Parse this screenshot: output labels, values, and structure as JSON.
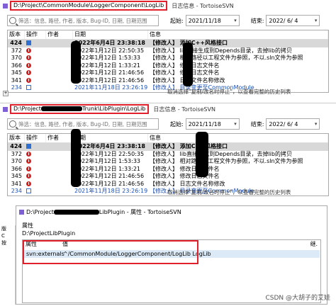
{
  "win1": {
    "path": "D:\\Project\\CommonModule\\LoggerComponent\\LogLib",
    "title_suffix": "日志信息 - TortoiseSVN",
    "search_placeholder": "筛选：信息, 路径, 作者, 版本, Bug-ID, 日期, 日期范围",
    "from_label": "起始:",
    "from_date": "2021/11/18",
    "to_label": "结束:",
    "to_date": "2022/ 6/ 4",
    "headers": [
      "版本",
      "操作",
      "作者",
      "日期",
      "信息"
    ],
    "rows": [
      {
        "rev": "424",
        "icon": "add",
        "date": "2022年6月4日 23:38:18",
        "msg": "【修改人】 添加C++风格接口",
        "style": "selected"
      },
      {
        "rev": "372",
        "icon": "error",
        "date": "2022年1月12日 22:50:35",
        "msg": "【修改人】 lib直接生成到Depends目录，去掉lib的拷贝",
        "style": ""
      },
      {
        "rev": "370",
        "icon": "error",
        "date": "2022年1月12日 1:53:33",
        "msg": "【修改人】 相对路径以工程文件为参照，不以.sln文件为参照",
        "style": ""
      },
      {
        "rev": "366",
        "icon": "error",
        "date": "2022年1月12日 1:33:21",
        "msg": "【修改人】 修改日志文件名",
        "style": ""
      },
      {
        "rev": "345",
        "icon": "error",
        "date": "2022年1月12日 21:46:56",
        "msg": "【修改人】 修改日志文件名",
        "style": ""
      },
      {
        "rev": "341",
        "icon": "error",
        "date": "2022年1月12日 21:46:56",
        "msg": "【修改人】 日志文件名称修改",
        "style": ""
      },
      {
        "rev": "234",
        "icon": "add-hollow",
        "date": "2021年11月18日 23:26:19",
        "msg": "【修改人】 目录变更至CommonModule",
        "style": "blue"
      }
    ],
    "status": "取消选择\"复制/改名时停止\"，以查看完整的历史列表"
  },
  "win2": {
    "path_start": "D:\\Project",
    "path_end": "Trunk\\LibPlugin\\LogLib",
    "title_suffix": "日志信息 - TortoiseSVN",
    "search_placeholder": "筛选：信息, 路径, 作者, 版本, Bug-ID, 日期, 日期范围",
    "from_label": "起始:",
    "from_date": "2021/11/18",
    "to_label": "结束:",
    "to_date": "2022/ 6/ 4",
    "headers": [
      "版本",
      "操作",
      "作者",
      "日期",
      "信息"
    ],
    "rows": [
      {
        "rev": "424",
        "icon": "add",
        "date": "2022年6月4日 23:38:18",
        "msg": "【修改人】 添加C++风格接口",
        "style": "selected"
      },
      {
        "rev": "372",
        "icon": "error",
        "date": "2022年1月12日 22:50:35",
        "msg": "【修改人】 lib直接生成到Depends目录，去掉lib的拷贝",
        "style": ""
      },
      {
        "rev": "370",
        "icon": "error",
        "date": "2022年1月12日 1:53:33",
        "msg": "【修改人】 相对路径以工程文件为参照，不以.sln文件为参照",
        "style": ""
      },
      {
        "rev": "366",
        "icon": "error",
        "date": "2022年1月12日 1:33:21",
        "msg": "【修改人】 修改日志文件名",
        "style": ""
      },
      {
        "rev": "345",
        "icon": "error",
        "date": "2022年1月12日 21:46:56",
        "msg": "【修改人】 修改日志文件名",
        "style": ""
      },
      {
        "rev": "341",
        "icon": "error",
        "date": "2022年1月12日 21:46:56",
        "msg": "【修改人】 日志文件名称修改",
        "style": ""
      },
      {
        "rev": "234",
        "icon": "add-hollow",
        "date": "2021年11月18日 23:26:19",
        "msg": "【修改人】 目录变更至CommonModule",
        "style": "blue"
      }
    ],
    "status": "取消选择\"复制/改名时停止\"，以查看完整的历史列表"
  },
  "dialog": {
    "title_start": "D:\\Project",
    "title_end": "LibPlugin - 属性 - TortoiseSVN",
    "group_label": "属性",
    "path_start": "D:\\Project",
    "path_end": "LibPlugin",
    "col_name": "属性",
    "col_value": "值",
    "col_extra": "继.",
    "prop_name": "svn:externals",
    "prop_value": "^/CommonModule/LoggerComponent/LogLib  LogLib"
  },
  "left_strip": {
    "items": [
      "版",
      "C",
      "按"
    ]
  },
  "watermark": "CSDN @大胡子的艾娃",
  "colors": {
    "highlight_red": "#e0202a",
    "link_blue": "#1a4fb4",
    "selected_gray": "#d8d8d8"
  }
}
